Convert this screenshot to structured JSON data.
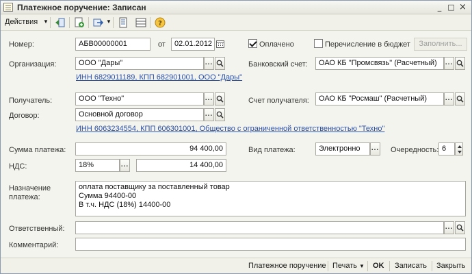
{
  "window": {
    "title": "Платежное поручение: Записан",
    "minimize": "_",
    "maximize": "□",
    "close": "×"
  },
  "toolbar": {
    "actions_label": "Действия",
    "icons": [
      "back-to-list-icon",
      "add-copy-icon",
      "go-to-icon",
      "document-structure-icon",
      "list-icon",
      "help-icon"
    ]
  },
  "form": {
    "number": {
      "label": "Номер:",
      "value": "АБВ00000001"
    },
    "date": {
      "label": "от",
      "value": "02.01.2012"
    },
    "paid": {
      "label": "Оплачено",
      "checked": true
    },
    "budget_transfer": {
      "label": "Перечисление в бюджет",
      "checked": false
    },
    "fill_button": "Заполнить...",
    "organization": {
      "label": "Организация:",
      "value": "ООО \"Дары\""
    },
    "bank_account": {
      "label": "Банковский счет:",
      "value": "ОАО КБ \"Промсвязь\" (Расчетный)"
    },
    "org_link": "ИНН 6829011189, КПП 682901001, ООО \"Дары\"",
    "recipient": {
      "label": "Получатель:",
      "value": "ООО \"Техно\""
    },
    "recipient_account": {
      "label": "Счет получателя:",
      "value": "ОАО КБ \"Росмаш\" (Расчетный)"
    },
    "contract": {
      "label": "Договор:",
      "value": "Основной договор"
    },
    "recipient_link": "ИНН 6063234554, КПП 606301001, Общество с ограниченной ответственностью \"Техно\"",
    "amount": {
      "label": "Сумма платежа:",
      "value": "94 400,00"
    },
    "payment_type": {
      "label": "Вид платежа:",
      "value": "Электронно"
    },
    "priority": {
      "label": "Очередность:",
      "value": "6"
    },
    "vat": {
      "label": "НДС:",
      "rate": "18%",
      "amount": "14 400,00"
    },
    "purpose": {
      "label_line1": "Назначение",
      "label_line2": "платежа:",
      "lines": [
        "оплата поставщику за поставленный товар",
        "Сумма 94400-00",
        "В т.ч. НДС  (18%) 14400-00"
      ]
    },
    "responsible": {
      "label": "Ответственный:",
      "value": ""
    },
    "comment": {
      "label": "Комментарий:",
      "value": ""
    },
    "dots": "...",
    "search_glyph": "🔍"
  },
  "bottom": {
    "print_form": "Платежное поручение",
    "print": "Печать",
    "ok": "OK",
    "save": "Записать",
    "close": "Закрыть"
  }
}
